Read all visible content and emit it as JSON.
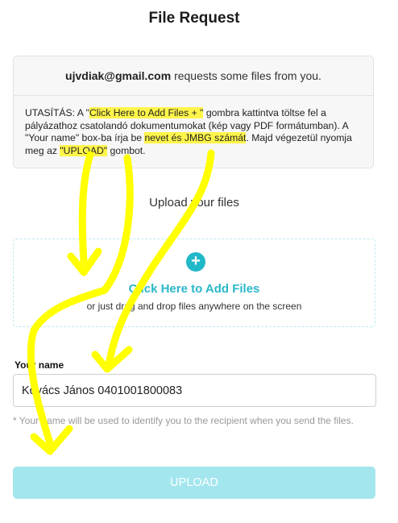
{
  "page": {
    "title": "File Request"
  },
  "request": {
    "email": "ujvdiak@gmail.com",
    "message": " requests some files from you."
  },
  "instructions": {
    "t1": "UTASÍTÁS: A \"",
    "h1": "Click Here to Add Files + \"",
    "t2": " gombra kattintva töltse fel a pályázathoz csatolandó dokumentumokat (kép vagy PDF formátumban). A \"Your name\" box-ba írja be ",
    "h2": "nevet és JMBG számát",
    "t3": ". Majd végezetül nyomja meg az ",
    "h3": "\"UPLOAD\"",
    "t4": " gombot."
  },
  "upload": {
    "label": "Upload your files"
  },
  "dropzone": {
    "icon": "plus-circle-icon",
    "link": "Click Here to Add Files",
    "subtext": "or just drag and drop files anywhere on the screen"
  },
  "name_field": {
    "label": "Your name",
    "value": "Kovács János 0401001800083",
    "hint": "* Your name will be used to identify you to the recipient when you send the files."
  },
  "submit": {
    "label": "UPLOAD"
  },
  "colors": {
    "accent": "#21b8c8",
    "button": "#a3e6ee",
    "highlight": "#ffff00"
  }
}
